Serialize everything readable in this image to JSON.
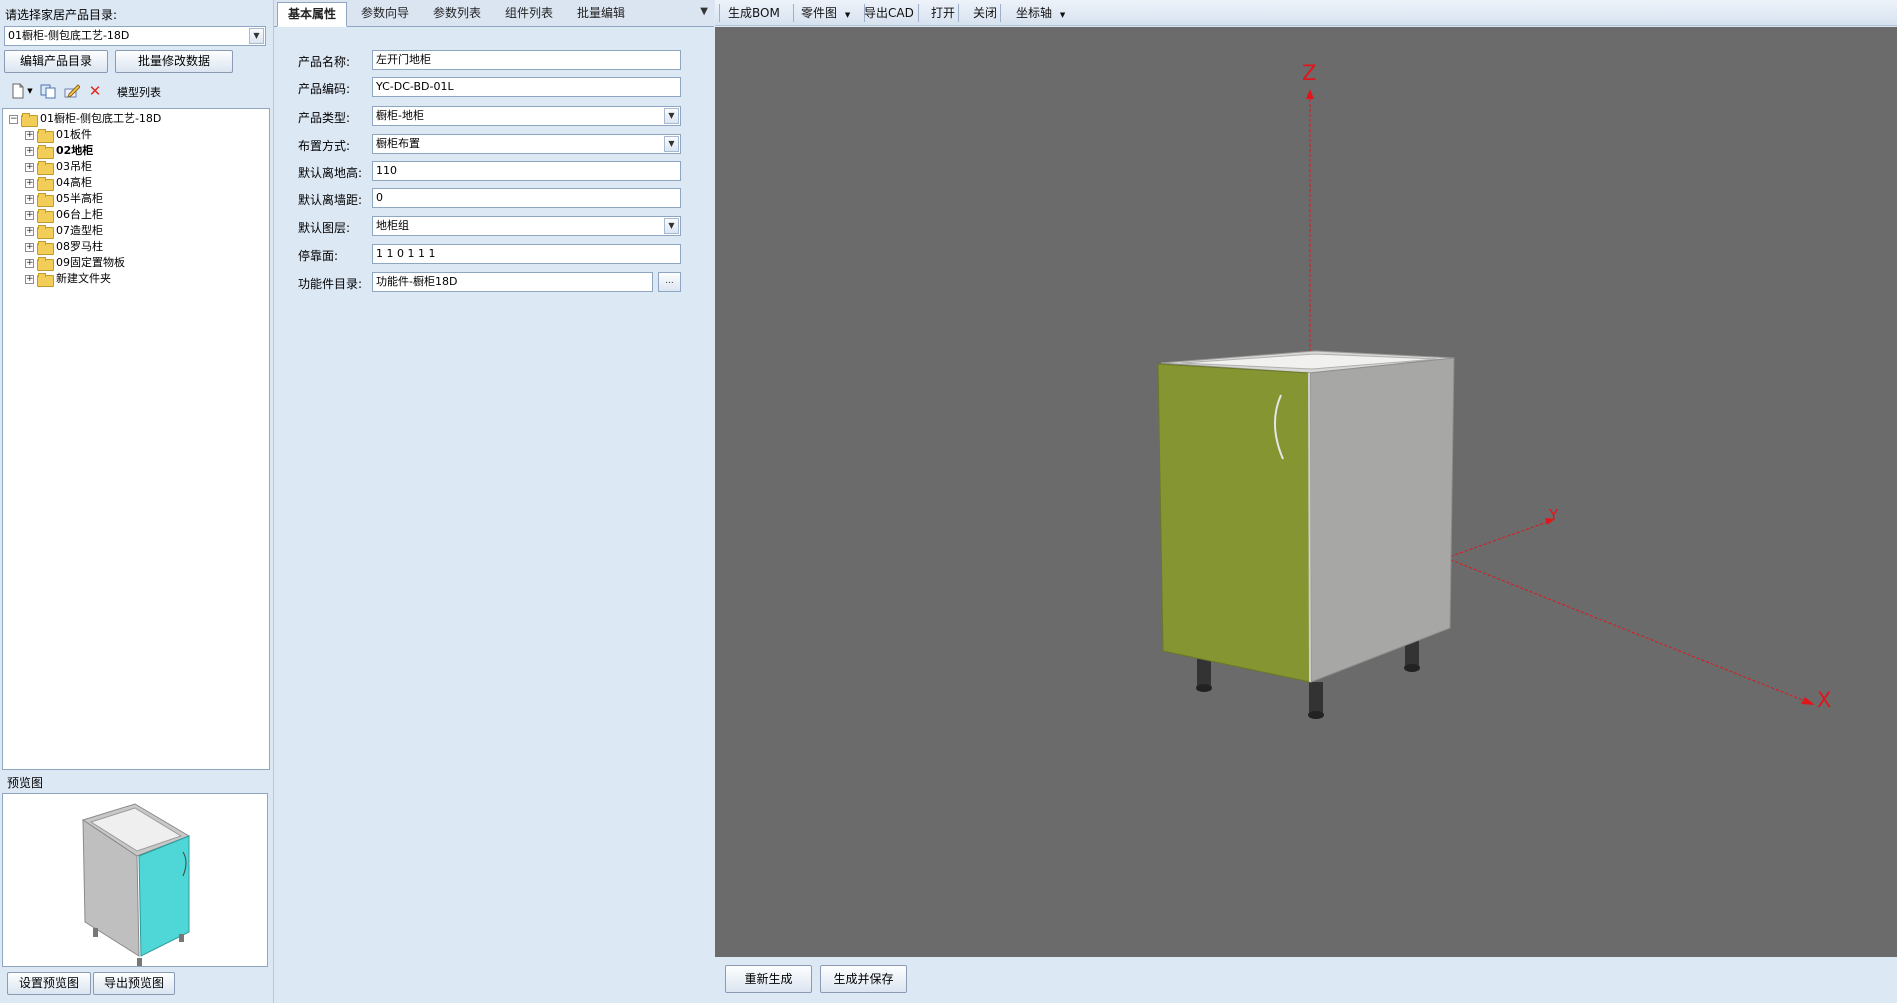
{
  "left": {
    "catalog_label": "请选择家居产品目录:",
    "catalog_value": "01橱柜-侧包底工艺-18D",
    "edit_catalog_button": "编辑产品目录",
    "batch_modify_button": "批量修改数据",
    "model_list_label": "模型列表",
    "tree": {
      "root": "01橱柜-侧包底工艺-18D",
      "children": [
        {
          "label": "01板件",
          "bold": false
        },
        {
          "label": "02地柜",
          "bold": true
        },
        {
          "label": "03吊柜",
          "bold": false
        },
        {
          "label": "04高柜",
          "bold": false
        },
        {
          "label": "05半高柜",
          "bold": false
        },
        {
          "label": "06台上柜",
          "bold": false
        },
        {
          "label": "07造型柜",
          "bold": false
        },
        {
          "label": "08罗马柱",
          "bold": false
        },
        {
          "label": "09固定置物板",
          "bold": false
        },
        {
          "label": "新建文件夹",
          "bold": false
        }
      ]
    },
    "preview_label": "预览图",
    "set_preview_button": "设置预览图",
    "export_preview_button": "导出预览图"
  },
  "tabs": [
    "基本属性",
    "参数向导",
    "参数列表",
    "组件列表",
    "批量编辑"
  ],
  "active_tab": 0,
  "form": {
    "name_label": "产品名称:",
    "name_value": "左开门地柜",
    "code_label": "产品编码:",
    "code_value": "YC-DC-BD-01L",
    "type_label": "产品类型:",
    "type_value": "橱柜-地柜",
    "layout_label": "布置方式:",
    "layout_value": "橱柜布置",
    "floor_height_label": "默认离地高:",
    "floor_height_value": "110",
    "wall_dist_label": "默认离墙距:",
    "wall_dist_value": "0",
    "layer_label": "默认图层:",
    "layer_value": "地柜组",
    "dock_label": "停靠面:",
    "dock_value": "1 1 0 1 1 1",
    "func_dir_label": "功能件目录:",
    "func_dir_value": "功能件-橱柜18D",
    "func_dir_button": "..."
  },
  "toolbar": {
    "gen_bom": "生成BOM",
    "part_drawing": "零件图",
    "export_cad": "导出CAD",
    "open": "打开",
    "close": "关闭",
    "axis": "坐标轴"
  },
  "viewport": {
    "axis_z": "Z",
    "axis_y": "Y",
    "axis_x": "X",
    "axis_color": "#e0161b",
    "door_color": "#849532",
    "cabinet_color": "#a7a7a5",
    "background": "#6b6b6b"
  },
  "bottom": {
    "regenerate_button": "重新生成",
    "generate_save_button": "生成并保存"
  }
}
